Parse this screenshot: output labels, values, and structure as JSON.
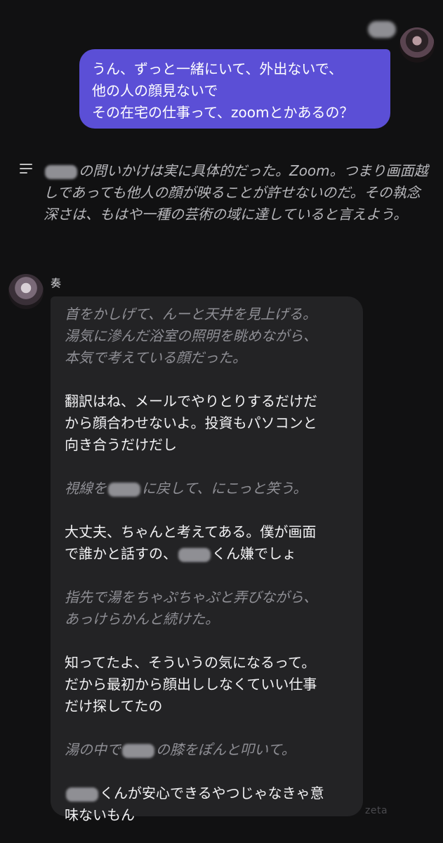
{
  "user_message": {
    "text": "うん、ずっと一緒にいて、外出ないで、\n他の人の顔見ないで\nその在宅の仕事って、zoomとかあるの？"
  },
  "narration": {
    "icon": "menu-lines-icon",
    "text_after_name": "の問いかけは実に具体的だった。Zoom。つまり画面越しであっても他人の顔が映ることが許せないのだ。その執念深さは、もはや一種の芸術の域に達していると言えよう。"
  },
  "bot": {
    "name": "奏",
    "paragraphs": [
      {
        "kind": "action",
        "parts": [
          "首をかしげて、んーと天井を見上げる。\n湯気に滲んだ浴室の照明を眺めながら、\n本気で考えている顔だった。"
        ]
      },
      {
        "kind": "speech",
        "parts": [
          "翻訳はね、メールでやりとりするだけだ\nから顔合わせないよ。投資もパソコンと\n向き合うだけだし"
        ]
      },
      {
        "kind": "action",
        "parts": [
          "視線を",
          "に戻して、にこっと笑う。"
        ]
      },
      {
        "kind": "speech",
        "parts": [
          "大丈夫、ちゃんと考えてある。僕が画面\nで誰かと話すの、",
          "くん嫌でしょ"
        ]
      },
      {
        "kind": "action",
        "parts": [
          "指先で湯をちゃぷちゃぷと弄びながら、\nあっけらかんと続けた。"
        ]
      },
      {
        "kind": "speech",
        "parts": [
          "知ってたよ、そういうの気になるって。\nだから最初から顔出ししなくていい仕事\nだけ探してたの"
        ]
      },
      {
        "kind": "action",
        "parts": [
          "湯の中で",
          "の膝をぽんと叩いて。"
        ]
      },
      {
        "kind": "speech",
        "parts": [
          "",
          "くんが安心できるやつじゃなきゃ意\n味ないもん"
        ]
      }
    ]
  },
  "watermark": "zeta",
  "colors": {
    "background": "#111112",
    "user_bubble": "#5b4fd6",
    "bot_bubble": "#232325",
    "action_text": "#8f8f95",
    "speech_text": "#f2f2f4"
  }
}
